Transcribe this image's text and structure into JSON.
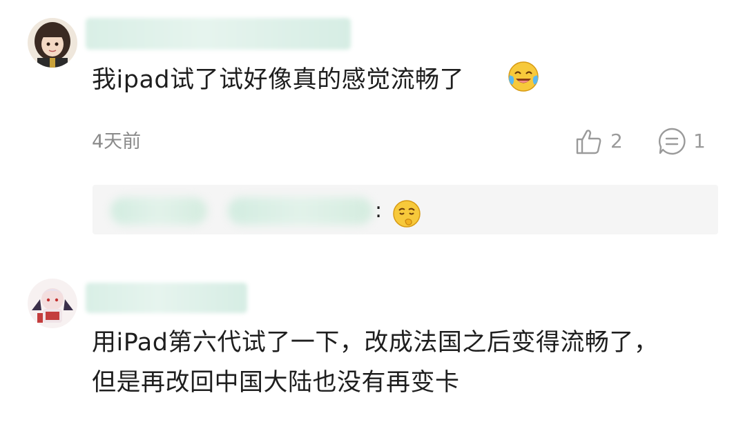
{
  "comments": [
    {
      "text": "我ipad试了试好像真的感觉流畅了",
      "time": "4天前",
      "like_count": "2",
      "reply_count": "1",
      "emoji": "laughing-tears-emoji"
    },
    {
      "text_line1": "用iPad第六代试了一下，改成法国之后变得流畅了，",
      "text_line2": "但是再改回中国大陆也没有再变卡"
    }
  ],
  "reply": {
    "colon": ":",
    "emoji": "thinking-emoji"
  },
  "colors": {
    "text": "#1e1e1e",
    "meta": "#8a8a8a",
    "reply_bg": "#f5f5f5",
    "blur_green": "#d9efe6"
  }
}
